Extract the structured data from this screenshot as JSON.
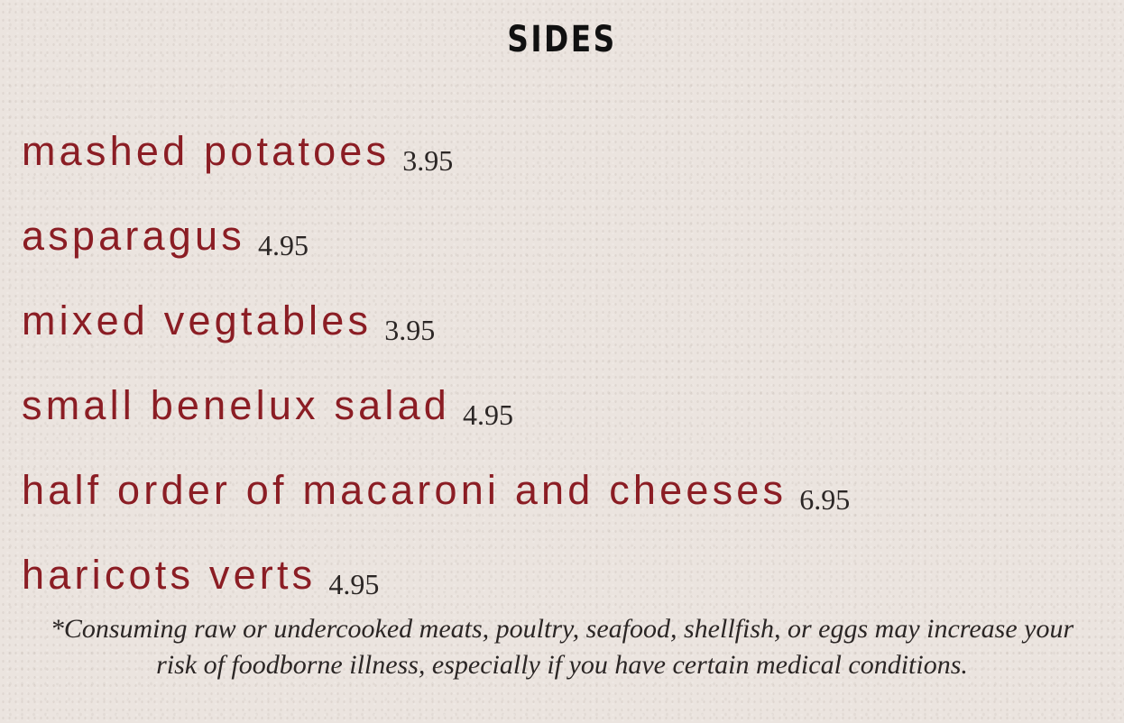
{
  "section": {
    "title": "SIDES"
  },
  "items": [
    {
      "name": "mashed potatoes",
      "price": "3.95"
    },
    {
      "name": "asparagus",
      "price": "4.95"
    },
    {
      "name": "mixed vegtables",
      "price": "3.95"
    },
    {
      "name": "small benelux salad",
      "price": "4.95"
    },
    {
      "name": "half order of macaroni and cheeses",
      "price": "6.95"
    },
    {
      "name": "haricots verts",
      "price": "4.95"
    }
  ],
  "disclaimer": {
    "line1": "*Consuming raw or undercooked meats, poultry, seafood, shellfish, or eggs may increase your",
    "line2": "risk of foodborne illness, especially if you have certain medical conditions."
  },
  "colors": {
    "background": "#ebe4df",
    "item_name": "#8b1d24",
    "price": "#2b2625",
    "heading": "#111111"
  }
}
